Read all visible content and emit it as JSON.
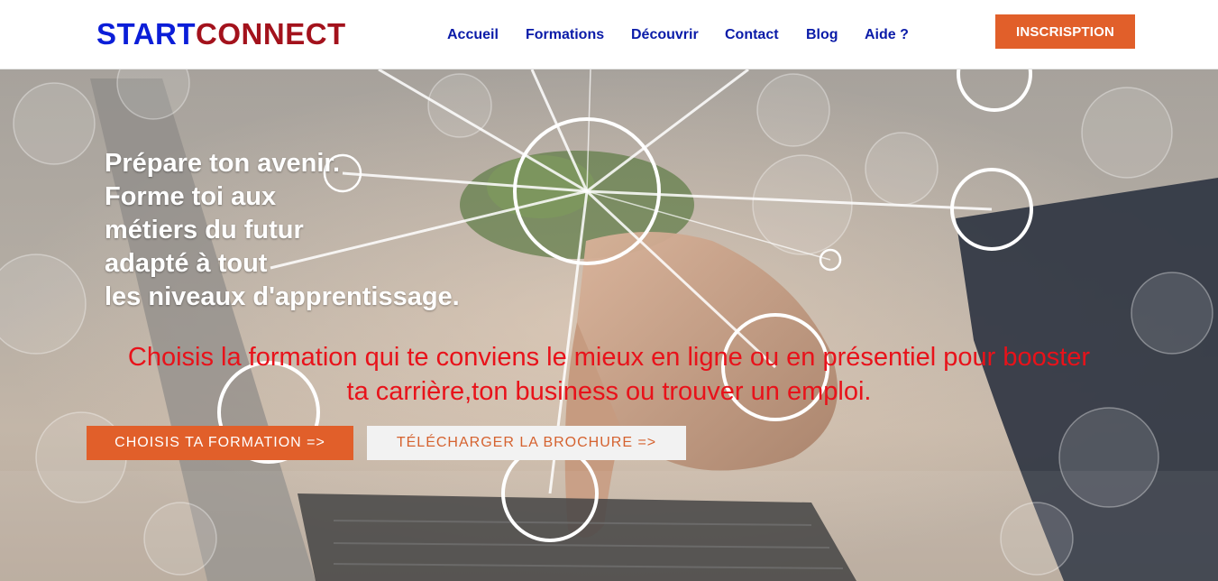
{
  "header": {
    "logo": {
      "part1": "START",
      "part2": "CONNECT"
    },
    "nav": [
      {
        "label": "Accueil"
      },
      {
        "label": "Formations"
      },
      {
        "label": "Découvrir"
      },
      {
        "label": "Contact"
      },
      {
        "label": "Blog"
      },
      {
        "label": "Aide ?"
      }
    ],
    "signup_label": "INSCRISPTION"
  },
  "hero": {
    "headline": [
      "Prépare ton avenir.",
      "Forme toi aux",
      "métiers du futur",
      "adapté à tout",
      "les niveaux d'apprentissage."
    ],
    "subline": [
      "Choisis la formation qui te conviens le mieux en ligne ou en présentiel pour booster",
      "ta carrière,ton business ou trouver un emploi."
    ],
    "primary_button": "CHOISIS TA FORMATION =>",
    "secondary_button": "TÉLÉCHARGER LA BROCHURE =>"
  },
  "colors": {
    "logo_start": "#0b1ed8",
    "logo_connect": "#a3121c",
    "nav_link": "#0a1ba8",
    "accent": "#e15f2a",
    "subline": "#e8121a"
  }
}
